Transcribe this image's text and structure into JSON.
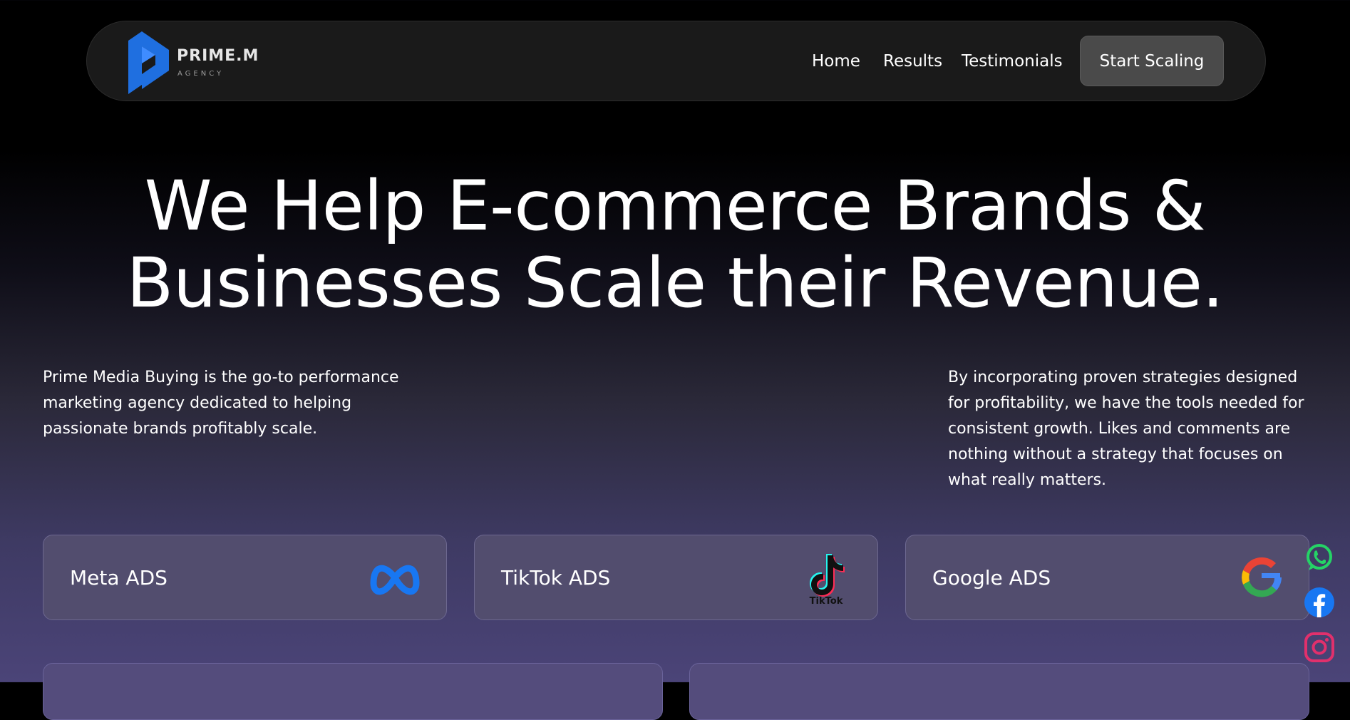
{
  "brand": {
    "name": "PRIME.M",
    "tagline": "AGENCY",
    "accent_color": "#1f6fe0",
    "logo_icon": "prime-logo-icon"
  },
  "nav": {
    "links": [
      {
        "label": "Home"
      },
      {
        "label": "Results"
      },
      {
        "label": "Testimonials"
      }
    ],
    "cta_label": "Start Scaling"
  },
  "hero": {
    "title_line1": "We Help E-commerce Brands &",
    "title_line2": "Businesses Scale their Revenue.",
    "intro_left": "Prime Media Buying is the go-to performance marketing agency dedicated to helping passionate brands profitably scale.",
    "intro_right": "By incorporating proven strategies designed for profitability, we have the tools needed for consistent growth. Likes and comments are nothing without a strategy that focuses on what really matters."
  },
  "services": [
    {
      "label": "Meta ADS",
      "icon": "meta-icon"
    },
    {
      "label": "TikTok ADS",
      "icon": "tiktok-icon",
      "icon_text": "TikTok"
    },
    {
      "label": "Google ADS",
      "icon": "google-icon"
    }
  ],
  "social": [
    {
      "name": "whatsapp-icon",
      "color": "#25d366"
    },
    {
      "name": "facebook-icon",
      "color": "#1877f2"
    },
    {
      "name": "instagram-icon",
      "color": "#e1306c"
    }
  ]
}
